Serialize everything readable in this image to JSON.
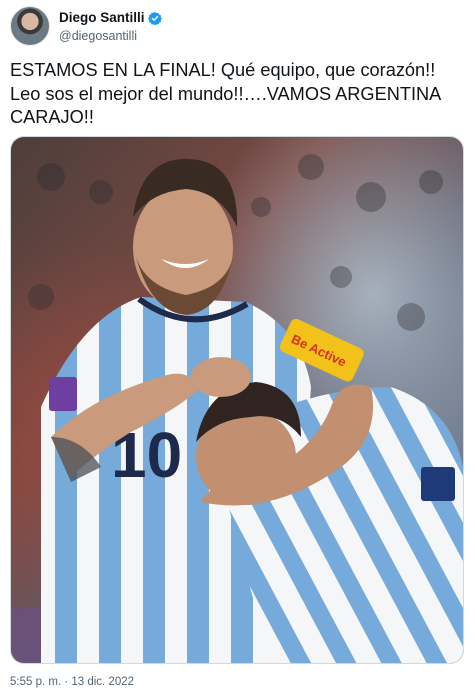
{
  "tweet": {
    "author": {
      "display_name": "Diego Santilli",
      "handle": "@diegosantilli",
      "verified": true,
      "verified_color": "#1d9bf0"
    },
    "text": "ESTAMOS EN LA FINAL! Qué equipo, que corazón!!\nLeo sos el mejor del mundo!!….VAMOS ARGENTINA\nCARAJO!!",
    "media": {
      "jersey_number": "10",
      "armband_text": "Be Active",
      "colors": {
        "sky_blue": "#75aadb",
        "stadium_red": "#8e3b3b",
        "armband_yellow": "#f2c21a"
      }
    },
    "timestamp": "5:55 p. m. · 13 dic. 2022"
  }
}
